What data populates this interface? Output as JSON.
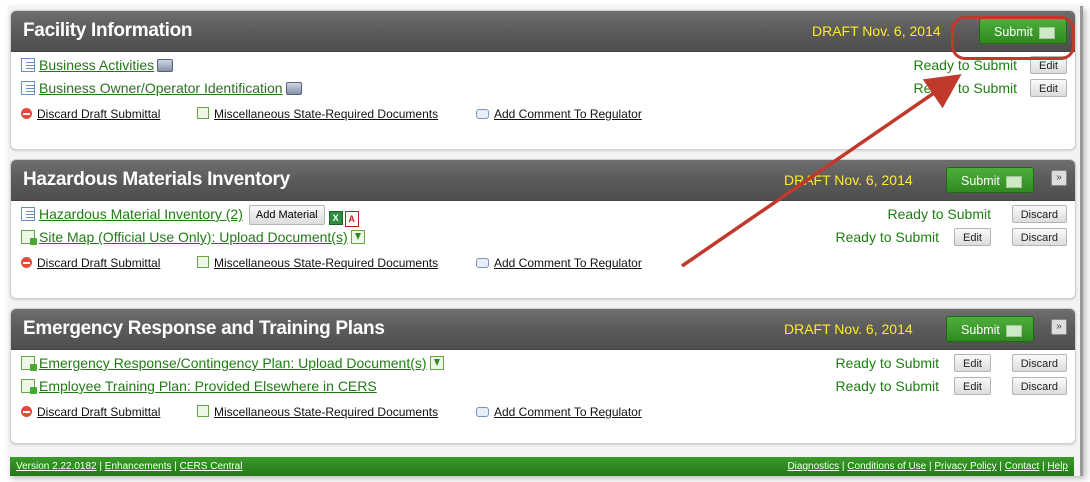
{
  "panels": [
    {
      "title": "Facility Information",
      "draft": "DRAFT Nov. 6, 2014",
      "submit": "Submit",
      "rows": [
        {
          "label": "Business Activities",
          "status": "Ready to Submit",
          "btn1": "Edit"
        },
        {
          "label": "Business Owner/Operator Identification",
          "status": "Ready to Submit",
          "btn1": "Edit"
        }
      ],
      "actions": {
        "discard": "Discard Draft Submittal",
        "docs": "Miscellaneous State-Required Documents",
        "comment": "Add Comment To Regulator"
      }
    },
    {
      "title": "Hazardous Materials Inventory",
      "draft": "DRAFT Nov. 6, 2014",
      "submit": "Submit",
      "rows": [
        {
          "label": "Hazardous Material Inventory (2)",
          "add": "Add Material",
          "status": "Ready to Submit",
          "btn2": "Discard"
        },
        {
          "label": "Site Map (Official Use Only): Upload Document(s)",
          "status": "Ready to Submit",
          "btn1": "Edit",
          "btn2": "Discard"
        }
      ],
      "actions": {
        "discard": "Discard Draft Submittal",
        "docs": "Miscellaneous State-Required Documents",
        "comment": "Add Comment To Regulator"
      }
    },
    {
      "title": "Emergency Response and Training Plans",
      "draft": "DRAFT Nov. 6, 2014",
      "submit": "Submit",
      "rows": [
        {
          "label": "Emergency Response/Contingency Plan: Upload Document(s)",
          "status": "Ready to Submit",
          "btn1": "Edit",
          "btn2": "Discard"
        },
        {
          "label": "Employee Training Plan: Provided Elsewhere in CERS",
          "status": "Ready to Submit",
          "btn1": "Edit",
          "btn2": "Discard"
        }
      ],
      "actions": {
        "discard": "Discard Draft Submittal",
        "docs": "Miscellaneous State-Required Documents",
        "comment": "Add Comment To Regulator"
      }
    }
  ],
  "footer": {
    "version": "Version 2.22.0182",
    "enhancements": "Enhancements",
    "central": "CERS Central",
    "diagnostics": "Diagnostics",
    "conditions": "Conditions of Use",
    "privacy": "Privacy Policy",
    "contact": "Contact",
    "help": "Help"
  },
  "colors": {
    "accent_green": "#2f8a20",
    "draft_yellow": "#ffea2a",
    "annotation_red": "#c0392b"
  }
}
